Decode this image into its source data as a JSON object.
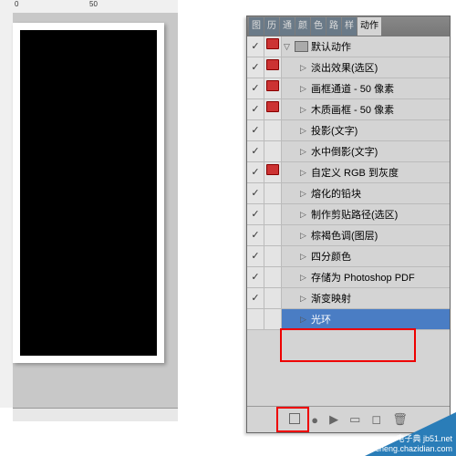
{
  "ruler": {
    "marks": [
      "0",
      "50"
    ]
  },
  "tabs": {
    "items": [
      "图",
      "历",
      "通",
      "颜",
      "色",
      "路",
      "样"
    ],
    "active": "动作"
  },
  "actionSet": {
    "name": "默认动作"
  },
  "actions": [
    {
      "checked": true,
      "dialog": true,
      "name": "淡出效果(选区)"
    },
    {
      "checked": true,
      "dialog": true,
      "name": "画框通道 - 50 像素"
    },
    {
      "checked": true,
      "dialog": true,
      "name": "木质画框 - 50 像素"
    },
    {
      "checked": true,
      "dialog": false,
      "name": "投影(文字)"
    },
    {
      "checked": true,
      "dialog": false,
      "name": "水中倒影(文字)"
    },
    {
      "checked": true,
      "dialog": true,
      "name": "自定义 RGB 到灰度"
    },
    {
      "checked": true,
      "dialog": false,
      "name": "熔化的铅块"
    },
    {
      "checked": true,
      "dialog": false,
      "name": "制作剪贴路径(选区)"
    },
    {
      "checked": true,
      "dialog": false,
      "name": "棕褐色调(图层)"
    },
    {
      "checked": true,
      "dialog": false,
      "name": "四分颜色"
    },
    {
      "checked": true,
      "dialog": false,
      "name": "存储为 Photoshop PDF"
    },
    {
      "checked": true,
      "dialog": false,
      "name": "渐变映射"
    },
    {
      "checked": false,
      "dialog": false,
      "name": "光环",
      "selected": true
    }
  ],
  "footer": {
    "icons": [
      "stop",
      "record",
      "play",
      "folder",
      "new",
      "trash"
    ]
  },
  "watermark": {
    "line1": "电子典 jb51.net",
    "line2": "jiaocheng.chazidian.com"
  }
}
